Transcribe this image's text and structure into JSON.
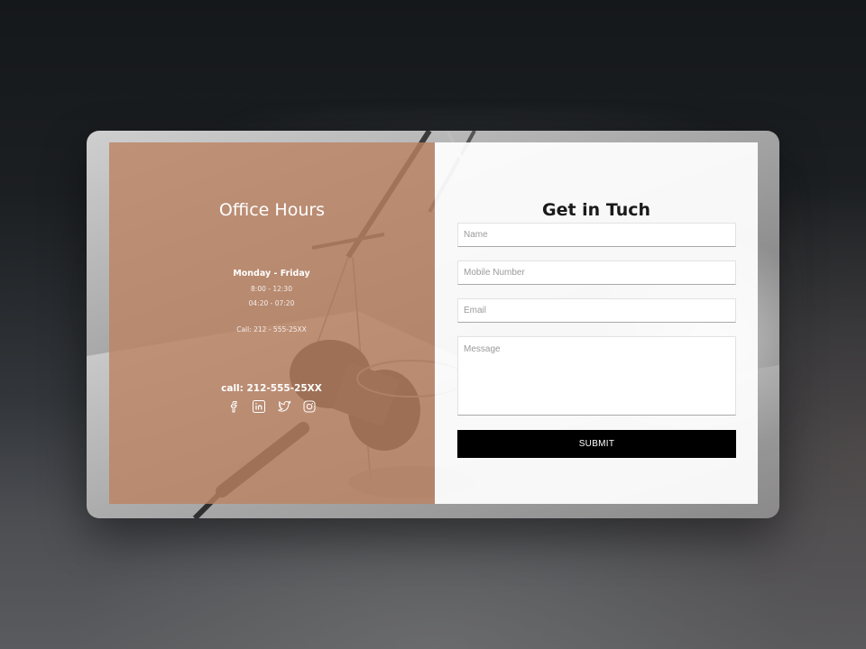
{
  "office": {
    "title": "Office Hours",
    "days": "Monday - Friday",
    "hours_morning": "8:00 - 12:30",
    "hours_afternoon": "04:20 - 07:20",
    "call_small": "Call: 212 - 555-25XX",
    "call_big": "call: 212-555-25XX",
    "socials": [
      "facebook-icon",
      "linkedin-icon",
      "twitter-icon",
      "instagram-icon"
    ]
  },
  "form": {
    "title": "Get in Tuch",
    "name_placeholder": "Name",
    "mobile_placeholder": "Mobile Number",
    "email_placeholder": "Email",
    "message_placeholder": "Message",
    "submit_label": "SUBMIT"
  },
  "colors": {
    "overlay": "#bc8262",
    "form_bg": "#ffffff",
    "submit_bg": "#000000"
  }
}
